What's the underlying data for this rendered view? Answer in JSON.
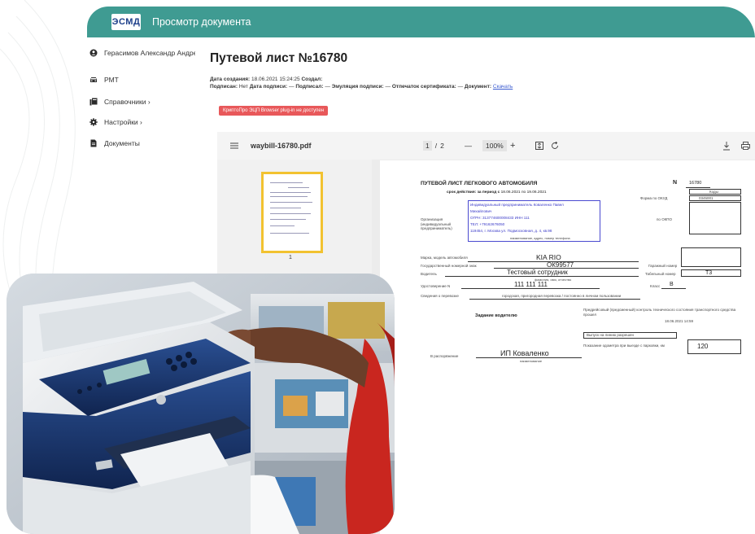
{
  "app": {
    "logo_prefix": "ЭСМ",
    "logo_suffix": "Д",
    "title": "Просмотр документа"
  },
  "sidebar": {
    "items": [
      {
        "label": "Герасимов Александр Андре",
        "icon": "user-icon"
      },
      {
        "label": "РМТ",
        "icon": "car-icon"
      },
      {
        "label": "Справочники ›",
        "icon": "books-icon"
      },
      {
        "label": "Настройки ›",
        "icon": "gear-icon"
      },
      {
        "label": "Документы",
        "icon": "document-icon"
      }
    ]
  },
  "document": {
    "title": "Путевой лист №16780",
    "created_label": "Дата создания:",
    "created_value": "18.06.2021 15:24:25",
    "creator_label": "Создал:",
    "signed_label": "Подписан:",
    "signed_value": "Нет",
    "sign_date_label": "Дата подписи:",
    "sign_date_value": "—",
    "signer_label": "Подписал:",
    "signer_value": "—",
    "emulation_label": "Эмуляция подписи:",
    "emulation_value": "—",
    "cert_label": "Отпечаток сертификата:",
    "cert_value": "—",
    "doc_label": "Документ:",
    "download_link": "Скачать",
    "plugin_warning": "КриптоПро ЭЦП Browser plug-in не доступен"
  },
  "pdf_viewer": {
    "menu_icon": "menu-icon",
    "filename": "waybill-16780.pdf",
    "page_current": "1",
    "page_separator": "/",
    "page_total": "2",
    "zoom_out": "—",
    "zoom_level": "100%",
    "zoom_in": "+",
    "thumbnail_page": "1"
  },
  "waybill": {
    "heading": "ПУТЕВОЙ ЛИСТ ЛЕГКОВОГО АВТОМОБИЛЯ",
    "number_label": "N",
    "number_value": "16780",
    "period_label": "срок действия: за период с",
    "period_from": "18.06.2021",
    "period_to_label": "по",
    "period_to": "19.06.2021",
    "code_label": "Коды",
    "okud_label": "Форма по ОКУД",
    "okud_value": "0345001",
    "okpo_label": "по ОКПО",
    "org_label": "Организация (индивидуальный предприниматель)",
    "org_lines": [
      "Индивидуальный предприниматель Коваленко Павел",
      "Михайлович",
      "ОГРН: 313774600008433 ИНН 111",
      "ТЕЛ: +79162676050",
      "119454, г. Москва ул. Подмосковная, д. 4, кв.98"
    ],
    "org_caption": "наименование, адрес, номер телефона",
    "car_label": "Марка, модель автомобиля",
    "car_value": "KIA RIO",
    "plate_label": "Государственный номерной знак",
    "plate_value": "ОК99577",
    "garage_label": "Гаражный номер",
    "driver_label": "Водитель",
    "driver_value": "Тестовый сотрудник",
    "driver_caption": "фамилия, имя, отчество",
    "tabel_label": "Табельный номер",
    "tabel_value": "Т3",
    "license_label": "Удостоверение N",
    "license_value": "111 111 111",
    "class_label": "Класс",
    "class_value": "В",
    "escort_label": "Сведения о перевозке",
    "escort_value": "городская, пригородная перевозка / постоянно в личном пользовании",
    "task_label": "Задание водителю",
    "control_text": "Предрейсовый (предсменный) контроль технического состояния транспортного средства прошел",
    "control_date": "18.06.2021 14:59",
    "release_label": "Выпуск на линию разрешен",
    "odometer_label": "Показание одометра при выезде с парковки, км",
    "odometer_value": "120",
    "disposal_label": "В распоряжение",
    "disposal_value": "ИП Коваленко",
    "disposal_caption": "наименование"
  },
  "colors": {
    "header": "#3f9b92",
    "warning": "#e8585a",
    "thumbnail_border": "#f2c230",
    "link": "#3a5bd0"
  }
}
